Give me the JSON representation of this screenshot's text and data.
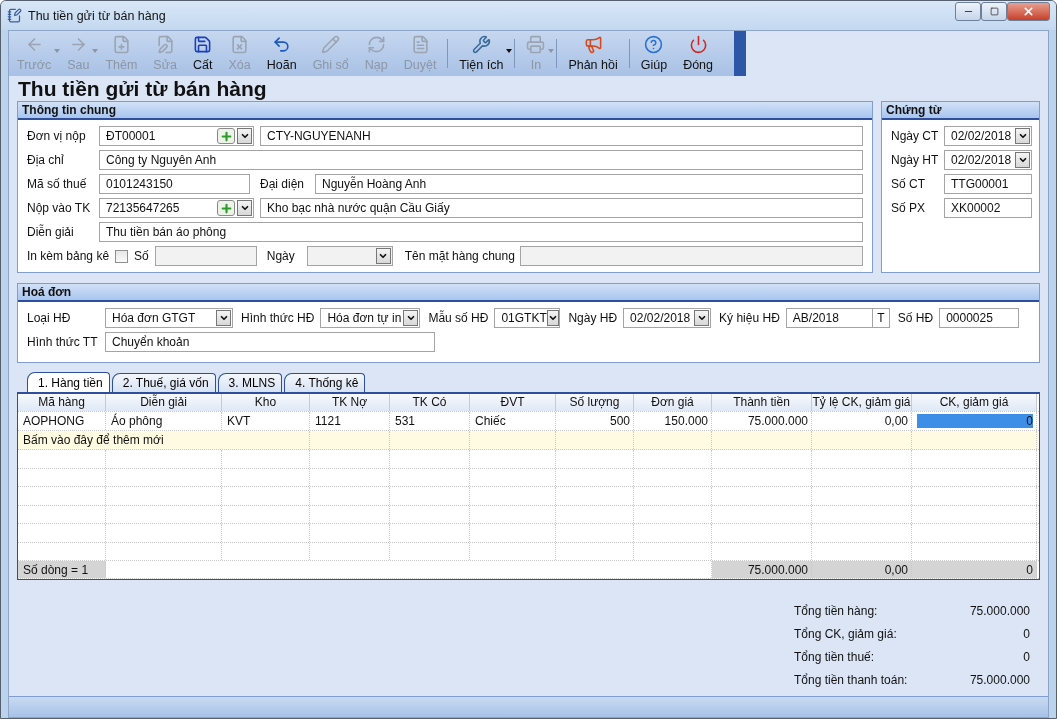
{
  "window": {
    "title": "Thu tiền gửi từ bán hàng"
  },
  "toolbar": {
    "buttons": [
      {
        "label": "Trước",
        "disabled": true,
        "menu": true
      },
      {
        "label": "Sau",
        "disabled": true,
        "menu": true
      },
      {
        "label": "Thêm",
        "disabled": true,
        "menu": false
      },
      {
        "label": "Sửa",
        "disabled": true,
        "menu": false
      },
      {
        "label": "Cất",
        "disabled": false,
        "menu": false
      },
      {
        "label": "Xóa",
        "disabled": true,
        "menu": false
      },
      {
        "label": "Hoãn",
        "disabled": false,
        "menu": false
      },
      {
        "label": "Ghi sổ",
        "disabled": true,
        "menu": false
      },
      {
        "label": "Nạp",
        "disabled": true,
        "menu": false
      },
      {
        "label": "Duyệt",
        "disabled": true,
        "menu": false
      },
      {
        "label": "Tiện ích",
        "disabled": false,
        "menu": true
      },
      {
        "label": "In",
        "disabled": true,
        "menu": true
      },
      {
        "label": "Phản hồi",
        "disabled": false,
        "menu": false
      },
      {
        "label": "Giúp",
        "disabled": false,
        "menu": false
      },
      {
        "label": "Đóng",
        "disabled": false,
        "menu": false
      }
    ]
  },
  "heading": "Thu tiền gửi từ bán hàng",
  "general": {
    "title": "Thông tin chung",
    "payer": {
      "label": "Đơn vị nộp",
      "code": "ĐT00001",
      "name": "CTY-NGUYENANH"
    },
    "address": {
      "label": "Địa chỉ",
      "value": "Công ty Nguyên Anh"
    },
    "tax": {
      "label": "Mã số thuế",
      "value": "0101243150"
    },
    "representative": {
      "label": "Đại diện",
      "value": "Nguyễn Hoàng Anh"
    },
    "account": {
      "label": "Nộp vào TK",
      "code": "72135647265",
      "name": "Kho bạc nhà nước quận Cầu Giấy"
    },
    "description": {
      "label": "Diễn giải",
      "value": "Thu tiền bán áo phông"
    },
    "attach": {
      "label": "In kèm bảng kê",
      "checked": false,
      "number_label": "Số",
      "date_label": "Ngày",
      "item_label": "Tên mặt hàng chung"
    }
  },
  "voucher": {
    "title": "Chứng từ",
    "fields": [
      {
        "label": "Ngày CT",
        "value": "02/02/2018",
        "kind": "date"
      },
      {
        "label": "Ngày HT",
        "value": "02/02/2018",
        "kind": "date"
      },
      {
        "label": "Số CT",
        "value": "TTG00001",
        "kind": "text"
      },
      {
        "label": "Số PX",
        "value": "XK00002",
        "kind": "text"
      }
    ]
  },
  "invoice": {
    "title": "Hoá đơn",
    "fields": [
      {
        "label": "Loại HĐ",
        "value": "Hóa đơn GTGT",
        "kind": "select"
      },
      {
        "label": "Hình thức HĐ",
        "value": "Hóa đơn tự in",
        "kind": "select"
      },
      {
        "label": "Mẫu số HĐ",
        "value": "01GTKT",
        "kind": "select"
      },
      {
        "label": "Ngày HĐ",
        "value": "02/02/2018",
        "kind": "select"
      },
      {
        "label": "Ký hiệu HĐ",
        "value": "AB/2018",
        "suffix": "T",
        "kind": "text"
      },
      {
        "label": "Số HĐ",
        "value": "0000025",
        "kind": "text"
      }
    ],
    "payment": {
      "label": "Hình thức TT",
      "value": "Chuyển khoản"
    }
  },
  "tabs": [
    {
      "label": "1. Hàng tiền",
      "selected": true
    },
    {
      "label": "2. Thuế, giá vốn",
      "selected": false
    },
    {
      "label": "3. MLNS",
      "selected": false
    },
    {
      "label": "4. Thống kê",
      "selected": false
    }
  ],
  "grid": {
    "columns": [
      "Mã hàng",
      "Diễn giải",
      "Kho",
      "TK Nợ",
      "TK Có",
      "ĐVT",
      "Số lượng",
      "Đơn giá",
      "Thành tiền",
      "Tỷ lệ CK, giảm giá",
      "CK, giảm  giá"
    ],
    "rows": [
      {
        "cells": [
          "AOPHONG",
          "Áo phông",
          "KVT",
          "1121",
          "531",
          "Chiếc",
          "500",
          "150.000",
          "75.000.000",
          "0,00",
          "0"
        ],
        "editing": true
      }
    ],
    "new_row_hint": "Bấm vào đây để thêm mới",
    "footer": {
      "count": "Số dòng = 1",
      "amount": "75.000.000",
      "rate": "0,00",
      "discount": "0"
    }
  },
  "totals": [
    {
      "label": "Tổng tiền hàng:",
      "value": "75.000.000"
    },
    {
      "label": "Tổng CK, giảm giá:",
      "value": "0"
    },
    {
      "label": "Tổng tiền thuế:",
      "value": "0"
    },
    {
      "label": "Tổng tiền thanh toán:",
      "value": "75.000.000"
    }
  ]
}
